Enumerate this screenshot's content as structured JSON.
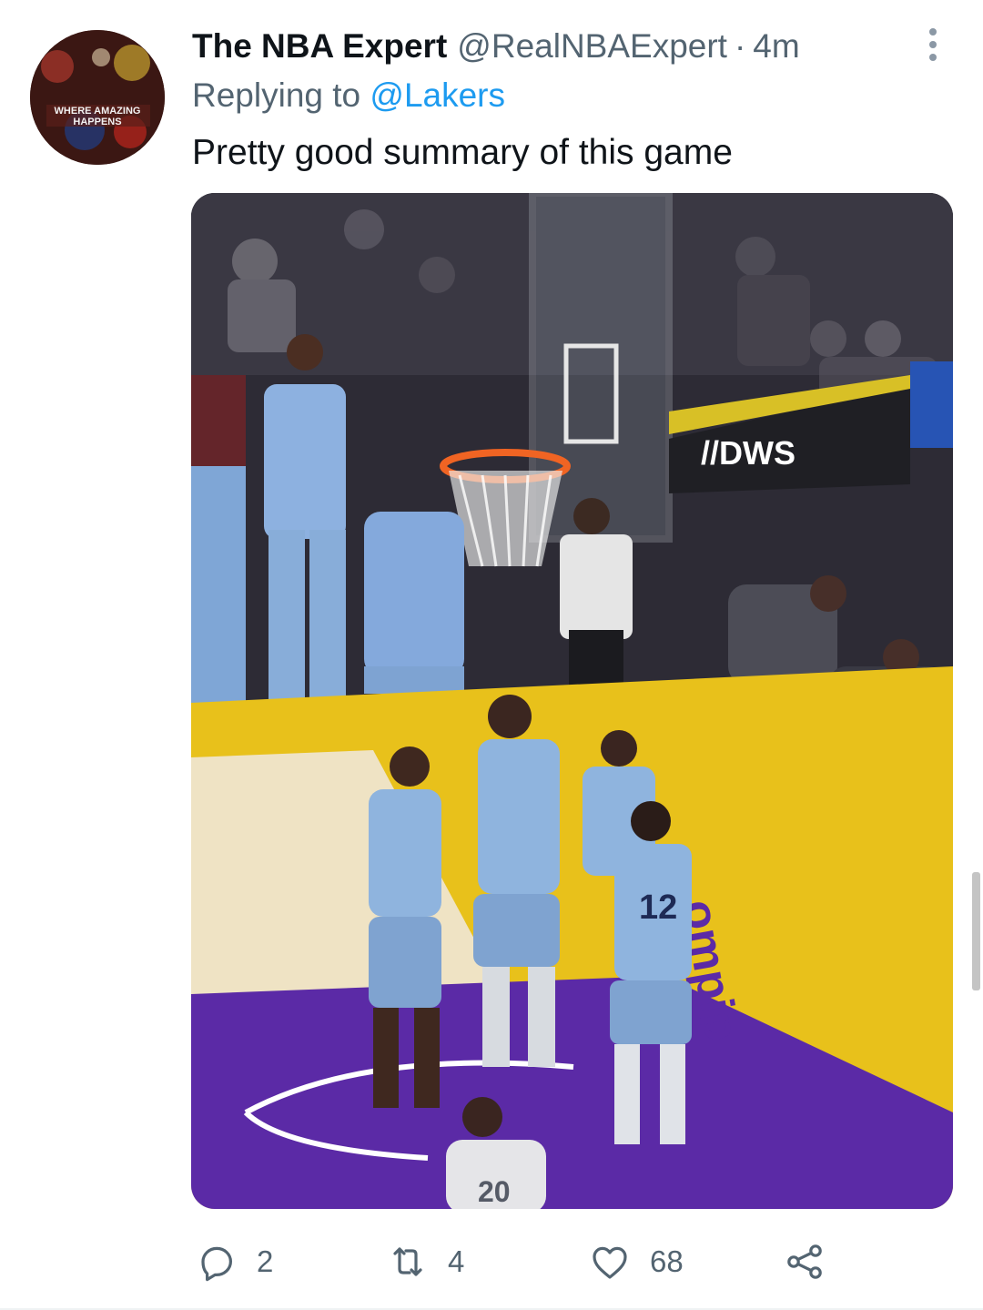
{
  "tweet": {
    "author": {
      "display_name": "The NBA Expert",
      "handle": "@RealNBAExpert",
      "avatar_caption": "WHERE AMAZING HAPPENS"
    },
    "separator": "·",
    "time": "4m",
    "reply_prefix": "Replying to",
    "reply_to": "@Lakers",
    "text": "Pretty good summary of this game",
    "media": {
      "sponsor_sign": "//DWS",
      "jersey_numbers": [
        "12",
        "20"
      ],
      "court_text": "ompip"
    }
  },
  "actions": {
    "reply_icon": "speech-bubble-icon",
    "reply_count": "2",
    "retweet_icon": "retweet-arrows-icon",
    "retweet_count": "4",
    "like_icon": "heart-outline-icon",
    "like_count": "68",
    "share_icon": "share-nodes-icon"
  },
  "colors": {
    "text_primary": "#0f1419",
    "text_secondary": "#536471",
    "link": "#1d9bf0",
    "jersey": "#8fb4de",
    "court_gold": "#e8c11b",
    "paint_purple": "#5b2aa6"
  }
}
